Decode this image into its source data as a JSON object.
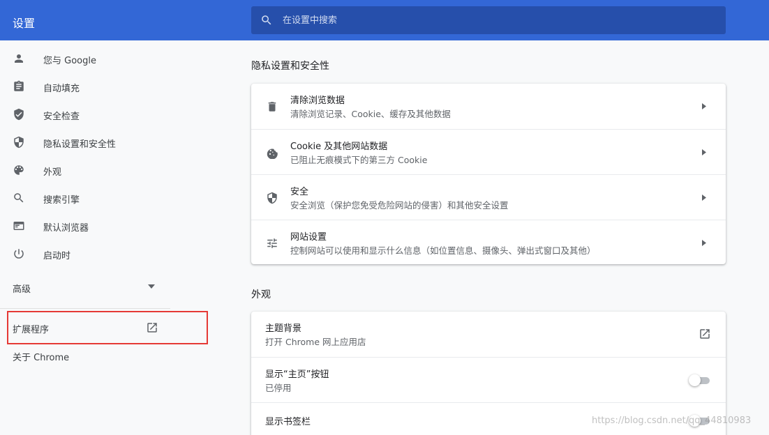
{
  "header": {
    "title": "设置",
    "search_placeholder": "在设置中搜索"
  },
  "sidebar": {
    "items": [
      {
        "label": "您与 Google",
        "icon": "person-icon"
      },
      {
        "label": "自动填充",
        "icon": "clipboard-icon"
      },
      {
        "label": "安全检查",
        "icon": "shield-check-icon"
      },
      {
        "label": "隐私设置和安全性",
        "icon": "shield-half-icon"
      },
      {
        "label": "外观",
        "icon": "palette-icon"
      },
      {
        "label": "搜索引擎",
        "icon": "search-icon"
      },
      {
        "label": "默认浏览器",
        "icon": "browser-window-icon"
      },
      {
        "label": "启动时",
        "icon": "power-icon"
      }
    ],
    "advanced": "高级",
    "extensions": "扩展程序",
    "about": "关于 Chrome"
  },
  "privacy": {
    "title": "隐私设置和安全性",
    "rows": [
      {
        "title": "清除浏览数据",
        "subtitle": "清除浏览记录、Cookie、缓存及其他数据"
      },
      {
        "title": "Cookie 及其他网站数据",
        "subtitle": "已阻止无痕模式下的第三方 Cookie"
      },
      {
        "title": "安全",
        "subtitle": "安全浏览（保护您免受危险网站的侵害）和其他安全设置"
      },
      {
        "title": "网站设置",
        "subtitle": "控制网站可以使用和显示什么信息（如位置信息、摄像头、弹出式窗口及其他）"
      }
    ]
  },
  "appearance": {
    "title": "外观",
    "rows": [
      {
        "title": "主题背景",
        "subtitle": "打开 Chrome 网上应用店"
      },
      {
        "title": "显示“主页”按钮",
        "subtitle": "已停用"
      },
      {
        "title": "显示书签栏"
      }
    ]
  },
  "watermark": "https://blog.csdn.net/qq_44810983",
  "colors": {
    "header": "#3367d6",
    "search": "#264fab",
    "highlight": "#e53935"
  }
}
